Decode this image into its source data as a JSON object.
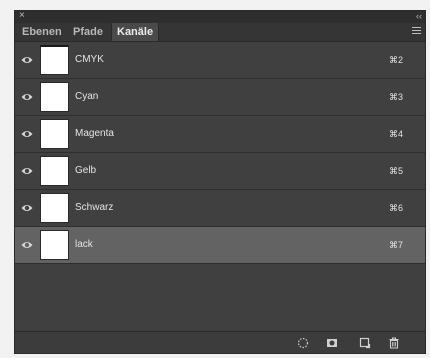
{
  "window": {
    "close_glyph": "×",
    "collapse_glyph": "‹‹"
  },
  "tabs": [
    {
      "label": "Ebenen",
      "active": false
    },
    {
      "label": "Pfade",
      "active": false
    },
    {
      "label": "Kanäle",
      "active": true
    }
  ],
  "channels": [
    {
      "name": "CMYK",
      "shortcut": "⌘2",
      "visible": true,
      "selected": false
    },
    {
      "name": "Cyan",
      "shortcut": "⌘3",
      "visible": true,
      "selected": false
    },
    {
      "name": "Magenta",
      "shortcut": "⌘4",
      "visible": true,
      "selected": false
    },
    {
      "name": "Gelb",
      "shortcut": "⌘5",
      "visible": true,
      "selected": false
    },
    {
      "name": "Schwarz",
      "shortcut": "⌘6",
      "visible": true,
      "selected": false
    },
    {
      "name": "lack",
      "shortcut": "⌘7",
      "visible": true,
      "selected": true
    }
  ],
  "footer_icons": [
    "load-selection-icon",
    "save-selection-icon",
    "new-channel-icon",
    "trash-icon"
  ],
  "colors": {
    "panel_bg": "#404040",
    "selected_row": "#636363",
    "text": "#e4e4e4"
  }
}
